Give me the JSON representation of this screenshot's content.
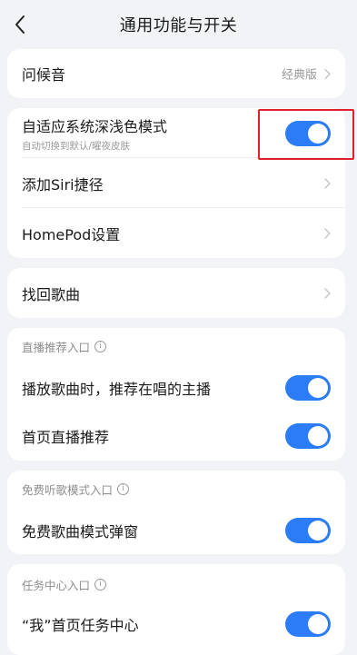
{
  "header": {
    "title": "通用功能与开关"
  },
  "greeting": {
    "label": "问候音",
    "value": "经典版"
  },
  "dark_mode": {
    "label": "自适应系统深浅色模式",
    "sub": "自动切换到默认/曜夜皮肤",
    "enabled": true
  },
  "siri": {
    "label": "添加Siri捷径"
  },
  "homepod": {
    "label": "HomePod设置"
  },
  "find_songs": {
    "label": "找回歌曲"
  },
  "live_section": {
    "title": "直播推荐入口",
    "items": [
      {
        "label": "播放歌曲时，推荐在唱的主播",
        "enabled": true
      },
      {
        "label": "首页直播推荐",
        "enabled": true
      }
    ]
  },
  "free_section": {
    "title": "免费听歌模式入口",
    "items": [
      {
        "label": "免费歌曲模式弹窗",
        "enabled": true
      }
    ]
  },
  "task_section": {
    "title": "任务中心入口",
    "items": [
      {
        "label": "“我”首页任务中心",
        "enabled": true
      }
    ]
  },
  "colors": {
    "accent": "#2b7cf6",
    "highlight": "#e0202a",
    "background": "#f2f3f7"
  },
  "icons": {
    "back": "chevron-left-icon",
    "chevron": "chevron-right-icon",
    "info": "info-icon"
  }
}
